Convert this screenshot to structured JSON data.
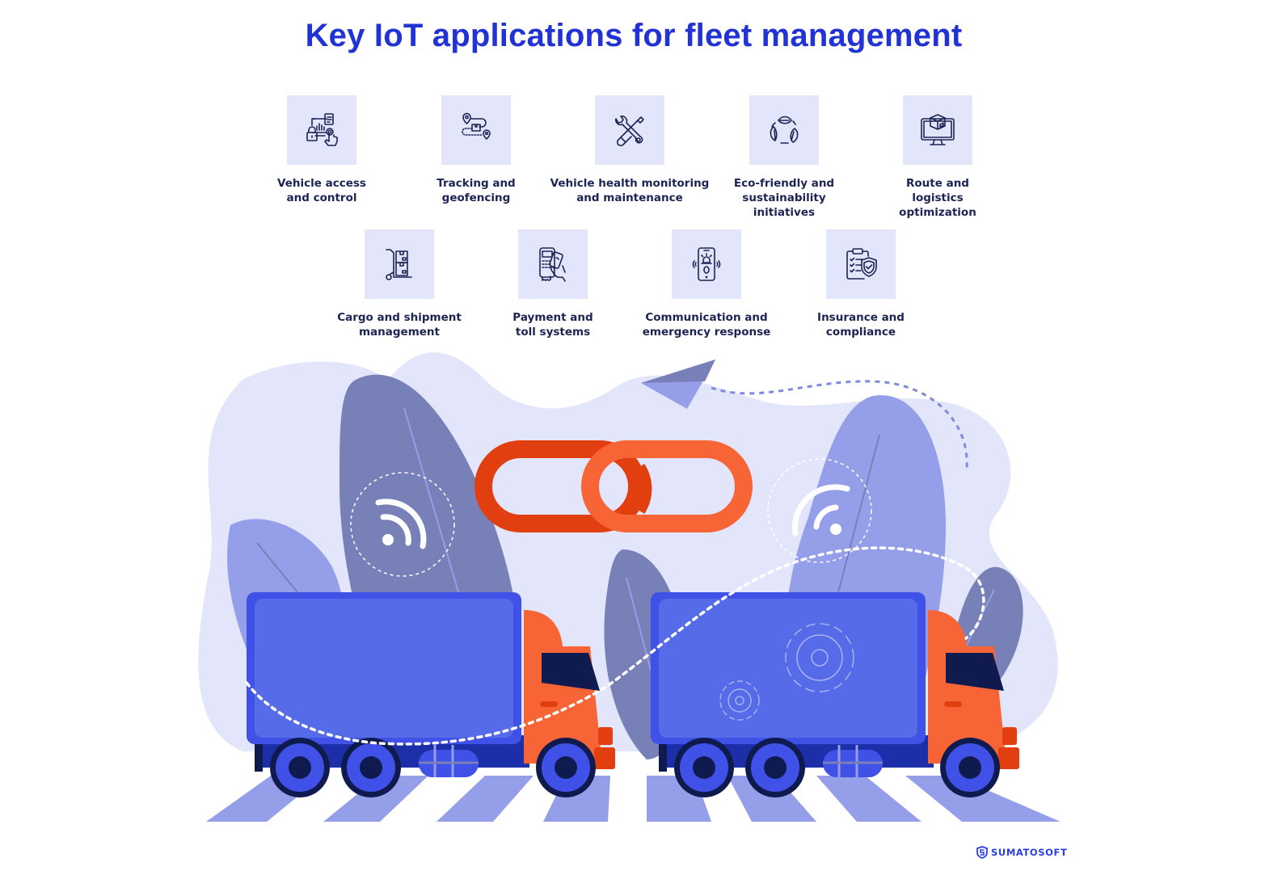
{
  "title": "Key IoT applications for fleet management",
  "applications": [
    {
      "label": "Vehicle access\nand control",
      "icon": "access-control-icon"
    },
    {
      "label": "Tracking and\ngeofencing",
      "icon": "tracking-route-icon"
    },
    {
      "label": "Vehicle health monitoring\nand maintenance",
      "icon": "wrench-screwdriver-icon"
    },
    {
      "label": "Eco-friendly and\nsustainability\ninitiatives",
      "icon": "leaves-recycle-icon"
    },
    {
      "label": "Route and\nlogistics\noptimization",
      "icon": "monitor-package-icon"
    },
    {
      "label": "Cargo and shipment\nmanagement",
      "icon": "hand-truck-boxes-icon"
    },
    {
      "label": "Payment and\ntoll systems",
      "icon": "card-terminal-icon"
    },
    {
      "label": "Communication and\nemergency response",
      "icon": "phone-alarm-icon"
    },
    {
      "label": "Insurance and\ncompliance",
      "icon": "clipboard-shield-icon"
    }
  ],
  "brand": {
    "name": "SUMATOSOFT"
  },
  "colors": {
    "title": "#2233d6",
    "tile_bg": "#e3e6fb",
    "label": "#1c2454",
    "truck_cargo": "#556be8",
    "truck_cab": "#f76435",
    "chain_dark": "#e23f10",
    "chain_light": "#f76435",
    "leaf_dark": "#7880b8",
    "leaf_light": "#959ee8",
    "blob": "#e3e6fb"
  }
}
